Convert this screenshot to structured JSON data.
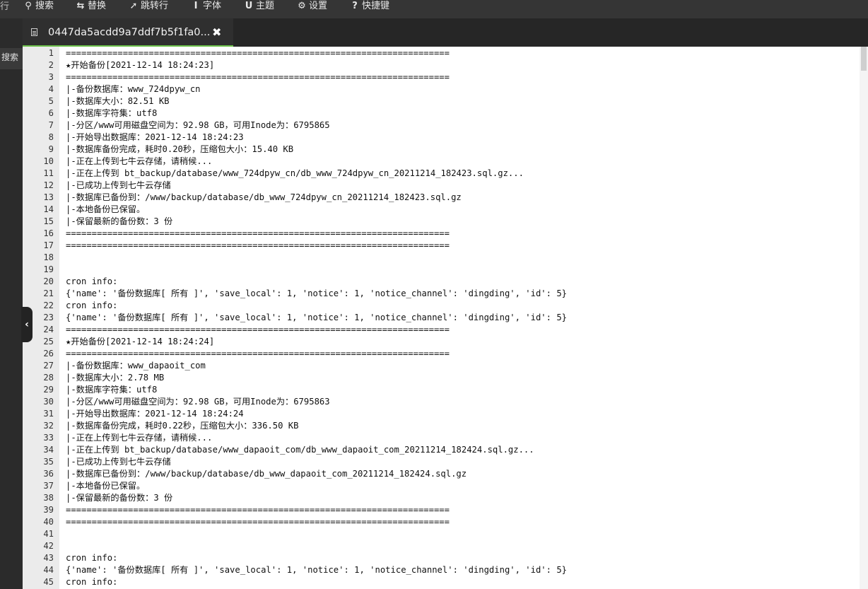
{
  "toolbar": {
    "edge_char": "行",
    "items": [
      {
        "icon": "search-icon",
        "glyph": "🔍",
        "label": "搜索"
      },
      {
        "icon": "replace-icon",
        "glyph": "⮂",
        "label": "替换"
      },
      {
        "icon": "pin-icon",
        "glyph": "✈",
        "label": "跳转行"
      },
      {
        "icon": "font-icon",
        "glyph": "I",
        "label": "字体"
      },
      {
        "icon": "theme-icon",
        "glyph": "U",
        "label": "主题"
      },
      {
        "icon": "gear-icon",
        "glyph": "⚙",
        "label": "设置"
      },
      {
        "icon": "question-icon",
        "glyph": "?",
        "label": "快捷键"
      }
    ]
  },
  "left_rail": {
    "search_tab_label": "搜索",
    "collapse_glyph": "‹"
  },
  "tab": {
    "title": "0447da5acdd9a7ddf7b5f1fa0...",
    "close_glyph": "✖"
  },
  "colors": {
    "tab_underline": "#6cc04a",
    "toolbar_bg": "#353535",
    "gutter_bg": "#ebebeb"
  },
  "editor": {
    "lines": [
      {
        "n": "1",
        "text": "=========================================================================="
      },
      {
        "n": "2",
        "text": "★开始备份[2021-12-14 18:24:23]"
      },
      {
        "n": "3",
        "text": "=========================================================================="
      },
      {
        "n": "4",
        "text": "|-备份数据库：www_724dpyw_cn"
      },
      {
        "n": "5",
        "text": "|-数据库大小：82.51 KB"
      },
      {
        "n": "6",
        "text": "|-数据库字符集：utf8"
      },
      {
        "n": "7",
        "text": "|-分区/www可用磁盘空间为：92.98 GB，可用Inode为：6795865"
      },
      {
        "n": "8",
        "text": "|-开始导出数据库：2021-12-14 18:24:23"
      },
      {
        "n": "9",
        "text": "|-数据库备份完成，耗时0.20秒，压缩包大小：15.40 KB"
      },
      {
        "n": "10",
        "text": "|-正在上传到七牛云存储，请稍候..."
      },
      {
        "n": "11",
        "text": "|-正在上传到 bt_backup/database/www_724dpyw_cn/db_www_724dpyw_cn_20211214_182423.sql.gz..."
      },
      {
        "n": "12",
        "text": "|-已成功上传到七牛云存储"
      },
      {
        "n": "13",
        "text": "|-数据库已备份到：/www/backup/database/db_www_724dpyw_cn_20211214_182423.sql.gz"
      },
      {
        "n": "14",
        "text": "|-本地备份已保留。"
      },
      {
        "n": "15",
        "text": "|-保留最新的备份数：3 份"
      },
      {
        "n": "16",
        "text": "=========================================================================="
      },
      {
        "n": "17",
        "text": "=========================================================================="
      },
      {
        "n": "18",
        "text": ""
      },
      {
        "n": "19",
        "text": ""
      },
      {
        "n": "20",
        "text": "cron info:"
      },
      {
        "n": "21",
        "text": "{'name': '备份数据库[ 所有 ]', 'save_local': 1, 'notice': 1, 'notice_channel': 'dingding', 'id': 5}"
      },
      {
        "n": "22",
        "text": "cron info:"
      },
      {
        "n": "23",
        "text": "{'name': '备份数据库[ 所有 ]', 'save_local': 1, 'notice': 1, 'notice_channel': 'dingding', 'id': 5}"
      },
      {
        "n": "24",
        "text": "=========================================================================="
      },
      {
        "n": "25",
        "text": "★开始备份[2021-12-14 18:24:24]"
      },
      {
        "n": "26",
        "text": "=========================================================================="
      },
      {
        "n": "27",
        "text": "|-备份数据库：www_dapaoit_com"
      },
      {
        "n": "28",
        "text": "|-数据库大小：2.78 MB"
      },
      {
        "n": "29",
        "text": "|-数据库字符集：utf8"
      },
      {
        "n": "30",
        "text": "|-分区/www可用磁盘空间为：92.98 GB，可用Inode为：6795863"
      },
      {
        "n": "31",
        "text": "|-开始导出数据库：2021-12-14 18:24:24"
      },
      {
        "n": "32",
        "text": "|-数据库备份完成，耗时0.22秒，压缩包大小：336.50 KB"
      },
      {
        "n": "33",
        "text": "|-正在上传到七牛云存储，请稍候..."
      },
      {
        "n": "34",
        "text": "|-正在上传到 bt_backup/database/www_dapaoit_com/db_www_dapaoit_com_20211214_182424.sql.gz..."
      },
      {
        "n": "35",
        "text": "|-已成功上传到七牛云存储"
      },
      {
        "n": "36",
        "text": "|-数据库已备份到：/www/backup/database/db_www_dapaoit_com_20211214_182424.sql.gz"
      },
      {
        "n": "37",
        "text": "|-本地备份已保留。"
      },
      {
        "n": "38",
        "text": "|-保留最新的备份数：3 份"
      },
      {
        "n": "39",
        "text": "=========================================================================="
      },
      {
        "n": "40",
        "text": "=========================================================================="
      },
      {
        "n": "41",
        "text": ""
      },
      {
        "n": "42",
        "text": ""
      },
      {
        "n": "43",
        "text": "cron info:"
      },
      {
        "n": "44",
        "text": "{'name': '备份数据库[ 所有 ]', 'save_local': 1, 'notice': 1, 'notice_channel': 'dingding', 'id': 5}"
      },
      {
        "n": "45",
        "text": "cron info:"
      }
    ]
  }
}
